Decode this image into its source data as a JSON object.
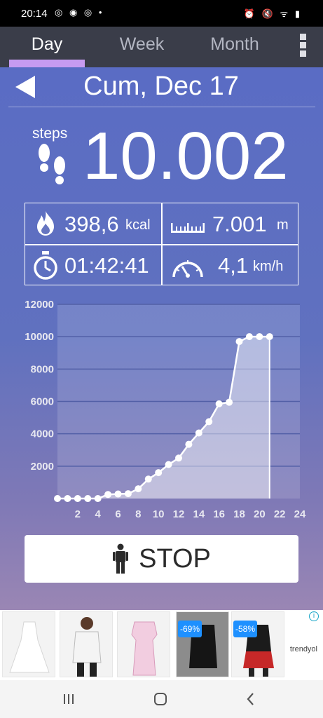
{
  "status_bar": {
    "time": "20:14"
  },
  "tabs": [
    {
      "label": "Day",
      "active": true
    },
    {
      "label": "Week",
      "active": false
    },
    {
      "label": "Month",
      "active": false
    }
  ],
  "header": {
    "date": "Cum, Dec 17"
  },
  "steps": {
    "label": "steps",
    "value": "10.002"
  },
  "stats": {
    "calories": {
      "value": "398,6",
      "unit": "kcal"
    },
    "distance": {
      "value": "7.001",
      "unit": "m"
    },
    "time": {
      "value": "01:42:41"
    },
    "speed": {
      "value": "4,1",
      "unit": "km/h"
    }
  },
  "chart_data": {
    "type": "area",
    "x_ticks": [
      "2",
      "4",
      "6",
      "8",
      "10",
      "12",
      "14",
      "16",
      "18",
      "20",
      "22",
      "24"
    ],
    "y_ticks": [
      "2000",
      "4000",
      "6000",
      "8000",
      "10000",
      "12000"
    ],
    "xlim": [
      0,
      24
    ],
    "ylim": [
      0,
      12000
    ],
    "x": [
      0,
      1,
      2,
      3,
      4,
      5,
      6,
      7,
      8,
      9,
      10,
      11,
      12,
      13,
      14,
      15,
      16,
      17,
      18,
      19,
      20,
      21
    ],
    "values": [
      0,
      0,
      0,
      0,
      0,
      250,
      280,
      300,
      600,
      1200,
      1600,
      2100,
      2500,
      3350,
      4050,
      4750,
      5850,
      5950,
      9700,
      10002,
      10002,
      10002
    ],
    "colors": {
      "line": "#ffffff",
      "fill": "rgba(255,255,255,0.45)",
      "grid": "#525fa6",
      "ticks": "#e8e8f0"
    }
  },
  "stop_button": {
    "label": "STOP"
  },
  "ad": {
    "badges": [
      "-69%",
      "-58%"
    ],
    "brand": "trendyol"
  }
}
